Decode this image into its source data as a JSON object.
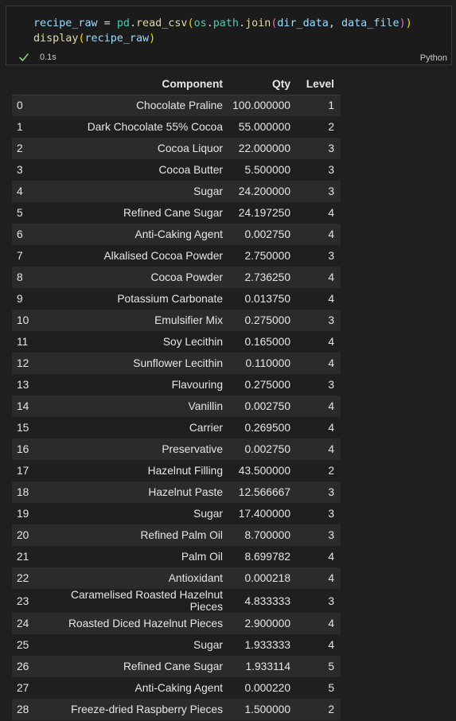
{
  "cell": {
    "code_line1_parts": [
      "recipe_raw",
      " = ",
      "pd",
      ".",
      "read_csv",
      "(",
      "os",
      ".",
      "path",
      ".",
      "join",
      "(",
      "dir_data",
      ", ",
      "data_file",
      ")",
      ")"
    ],
    "code_line2_parts": [
      "display",
      "(",
      "recipe_raw",
      ")"
    ],
    "exec_time": "0.1s",
    "language": "Python"
  },
  "table": {
    "columns": [
      "",
      "Component",
      "Qty",
      "Level"
    ],
    "rows": [
      [
        "0",
        "Chocolate Praline",
        "100.000000",
        "1"
      ],
      [
        "1",
        "Dark Chocolate 55% Cocoa",
        "55.000000",
        "2"
      ],
      [
        "2",
        "Cocoa Liquor",
        "22.000000",
        "3"
      ],
      [
        "3",
        "Cocoa Butter",
        "5.500000",
        "3"
      ],
      [
        "4",
        "Sugar",
        "24.200000",
        "3"
      ],
      [
        "5",
        "Refined Cane Sugar",
        "24.197250",
        "4"
      ],
      [
        "6",
        "Anti-Caking Agent",
        "0.002750",
        "4"
      ],
      [
        "7",
        "Alkalised Cocoa Powder",
        "2.750000",
        "3"
      ],
      [
        "8",
        "Cocoa Powder",
        "2.736250",
        "4"
      ],
      [
        "9",
        "Potassium Carbonate",
        "0.013750",
        "4"
      ],
      [
        "10",
        "Emulsifier Mix",
        "0.275000",
        "3"
      ],
      [
        "11",
        "Soy Lecithin",
        "0.165000",
        "4"
      ],
      [
        "12",
        "Sunflower Lecithin",
        "0.110000",
        "4"
      ],
      [
        "13",
        "Flavouring",
        "0.275000",
        "3"
      ],
      [
        "14",
        "Vanillin",
        "0.002750",
        "4"
      ],
      [
        "15",
        "Carrier",
        "0.269500",
        "4"
      ],
      [
        "16",
        "Preservative",
        "0.002750",
        "4"
      ],
      [
        "17",
        "Hazelnut Filling",
        "43.500000",
        "2"
      ],
      [
        "18",
        "Hazelnut Paste",
        "12.566667",
        "3"
      ],
      [
        "19",
        "Sugar",
        "17.400000",
        "3"
      ],
      [
        "20",
        "Refined Palm Oil",
        "8.700000",
        "3"
      ],
      [
        "21",
        "Palm Oil",
        "8.699782",
        "4"
      ],
      [
        "22",
        "Antioxidant",
        "0.000218",
        "4"
      ],
      [
        "23",
        "Caramelised Roasted Hazelnut Pieces",
        "4.833333",
        "3"
      ],
      [
        "24",
        "Roasted Diced Hazelnut Pieces",
        "2.900000",
        "4"
      ],
      [
        "25",
        "Sugar",
        "1.933333",
        "4"
      ],
      [
        "26",
        "Refined Cane Sugar",
        "1.933114",
        "5"
      ],
      [
        "27",
        "Anti-Caking Agent",
        "0.000220",
        "5"
      ],
      [
        "28",
        "Freeze-dried Raspberry Pieces",
        "1.500000",
        "2"
      ]
    ]
  },
  "colors": {
    "success_check": "#89d185",
    "variable": "#9cdcfe",
    "function": "#dcdcaa",
    "module": "#4ec9b0",
    "bracket_level1": "#ffd700",
    "bracket_level2": "#da70d6"
  },
  "icons": {
    "status": "check-icon"
  }
}
